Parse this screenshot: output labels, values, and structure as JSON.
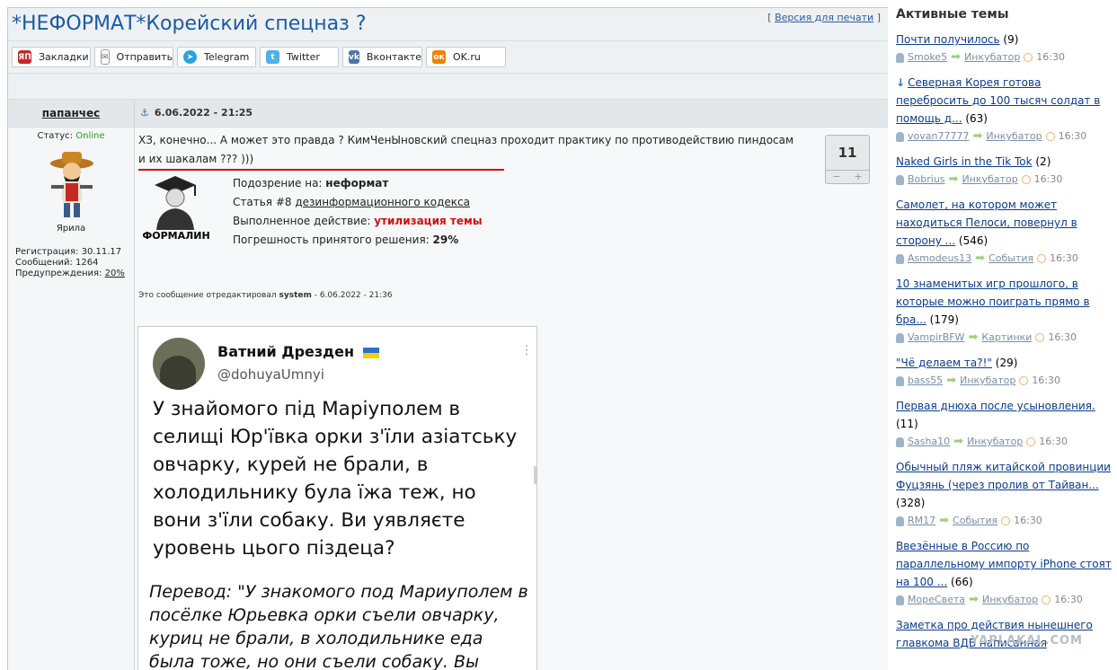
{
  "page": {
    "title": "*НЕФОРМАТ*Корейский спецназ ?",
    "print_open": "[",
    "print_link": "Версия для печати",
    "print_close": "]"
  },
  "share": [
    "Закладки",
    "Отправить",
    "Telegram",
    "Twitter",
    "Вконтакте",
    "OK.ru"
  ],
  "share_icons": [
    "ЯП",
    "✉",
    "➤",
    "t",
    "vk",
    "ок"
  ],
  "post": {
    "author": "папанчес",
    "date": "6.06.2022 - 21:25",
    "status_label": "Статус:",
    "status_value": "Online",
    "rank": "Ярила",
    "reg": "Регистрация: 30.11.17",
    "msgs": "Сообщений: 1264",
    "warn_label": "Предупреждения:",
    "warn_value": "20%",
    "text": "ХЗ, конечно... А может это правда ? КимЧенЫновский спецназ проходит практику по противодействию пиндосам и их шакалам ??? )))",
    "rating": "11",
    "rating_minus": "−",
    "rating_plus": "+",
    "mod_name": "ФОРМАЛИН",
    "mod_l1_label": "Подозрение на:",
    "mod_l1_value": "неформат",
    "mod_l2_label": "Статья #8",
    "mod_l2_value": "дезинформационного кодекса",
    "mod_l3_label": "Выполненное действие:",
    "mod_l3_value": "утилизация темы",
    "mod_l4_label": "Погрешность принятого решения:",
    "mod_l4_value": "29%",
    "edited_prefix": "Это сообщение отредактировал",
    "edited_user": "system",
    "edited_suffix": "- 6.06.2022 - 21:36"
  },
  "tweet": {
    "name": "Ватний Дрезден",
    "handle": "@dohuyaUmnyi",
    "body": "У знайомого під Маріуполем в селищі Юр'ївка орки з'їли азіатську овчарку, курей не брали, в холодильнику була їжа теж, но вони з'їли собаку. Ви уявляєте уровень цього піздеца?",
    "translation": "Перевод: \"У знакомого под Мариуполем в посёлке Юрьевка орки съели овчарку, куриц не брали, в холодильнике еда была тоже, но они съели собаку. Вы"
  },
  "sidebar": {
    "title": "Активные темы",
    "topics": [
      {
        "title": "Почти получилось",
        "count": "(9)",
        "user": "Smoke5",
        "forum": "Инкубатор",
        "time": "16:30"
      },
      {
        "title": "Северная Корея готова перебросить до 100 тысяч солдат в помощь д...",
        "count": "(63)",
        "user": "vovan77777",
        "forum": "Инкубатор",
        "time": "16:30"
      },
      {
        "title": "Naked Girls in the Tik Tok",
        "count": "(2)",
        "user": "Bobrius",
        "forum": "Инкубатор",
        "time": "16:30"
      },
      {
        "title": "Самолет, на котором может находиться Пелоси, повернул в сторону ...",
        "count": "(546)",
        "user": "Asmodeus13",
        "forum": "События",
        "time": "16:30"
      },
      {
        "title": "10 знаменитых игр прошлого, в которые можно поиграть прямо в бра...",
        "count": "(179)",
        "user": "VampirBFW",
        "forum": "Картинки",
        "time": "16:30"
      },
      {
        "title": "\"Чё делаем та?!\"",
        "count": "(29)",
        "user": "bass55",
        "forum": "Инкубатор",
        "time": "16:30"
      },
      {
        "title": "Первая днюха после усыновления.",
        "count": "(11)",
        "user": "Sasha10",
        "forum": "Инкубатор",
        "time": "16:30"
      },
      {
        "title": "Обычный пляж китайской провинции Фуцзянь (через пролив от Тайван...",
        "count": "(328)",
        "user": "RM17",
        "forum": "События",
        "time": "16:30"
      },
      {
        "title": "Ввезённые в Россию по параллельному импорту iPhone стоят на 100 ...",
        "count": "(66)",
        "user": "МореСвета",
        "forum": "Инкубатор",
        "time": "16:30"
      },
      {
        "title": "Заметка про действия нынешнего главкома ВДВ написанная",
        "count": "",
        "user": "",
        "forum": "",
        "time": ""
      }
    ]
  },
  "watermark": "YAPLAKAL.COM",
  "colors": {
    "title": "#1a5aa6",
    "link": "#0a3c8c",
    "online": "#2a9a2a",
    "red": "#d01010"
  }
}
